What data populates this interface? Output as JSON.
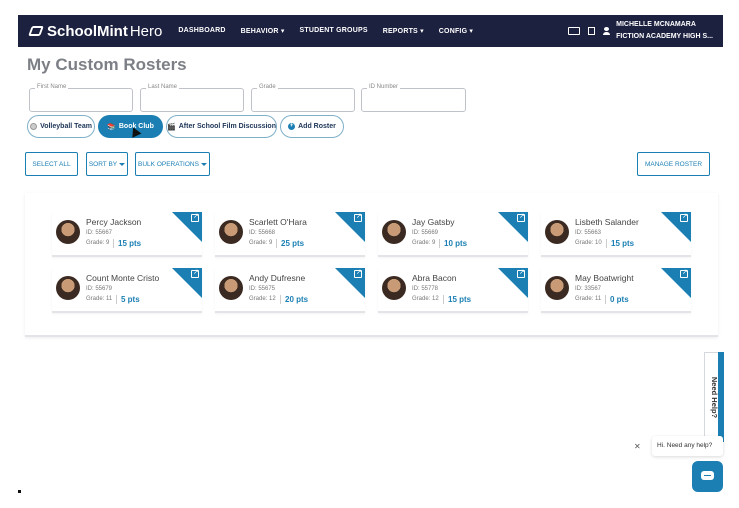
{
  "header": {
    "brand_bold": "SchoolMint",
    "brand_light": "Hero",
    "nav": [
      "DASHBOARD",
      "BEHAVIOR",
      "STUDENT GROUPS",
      "REPORTS",
      "CONFIG"
    ],
    "user_name": "MICHELLE MCNAMARA",
    "school": "FICTION ACADEMY HIGH S..."
  },
  "page": {
    "title": "My Custom Rosters"
  },
  "filters": {
    "first_name": "First Name",
    "last_name": "Last Name",
    "grade": "Grade",
    "id_number": "ID Number"
  },
  "rosters": {
    "items": [
      "Volleyball Team",
      "Book Club",
      "After School Film Discussion"
    ],
    "active": "Book Club",
    "add_label": "Add Roster"
  },
  "toolbar": {
    "select_all": "SELECT ALL",
    "sort_by": "SORT BY",
    "bulk_operations": "BULK OPERATIONS",
    "manage_roster": "MANAGE ROSTER"
  },
  "students": [
    {
      "name": "Percy Jackson",
      "id": "ID: 55667",
      "grade": "Grade: 9",
      "points": "15 pts"
    },
    {
      "name": "Scarlett O'Hara",
      "id": "ID: 55668",
      "grade": "Grade: 9",
      "points": "25 pts"
    },
    {
      "name": "Jay Gatsby",
      "id": "ID: 55669",
      "grade": "Grade: 9",
      "points": "10 pts"
    },
    {
      "name": "Lisbeth Salander",
      "id": "ID: 55663",
      "grade": "Grade: 10",
      "points": "15 pts"
    },
    {
      "name": "Count Monte Cristo",
      "id": "ID: 55679",
      "grade": "Grade: 11",
      "points": "5 pts"
    },
    {
      "name": "Andy Dufresne",
      "id": "ID: 55675",
      "grade": "Grade: 12",
      "points": "20 pts"
    },
    {
      "name": "Abra Bacon",
      "id": "ID: 55778",
      "grade": "Grade: 12",
      "points": "15 pts"
    },
    {
      "name": "May Boatwright",
      "id": "ID: 33567",
      "grade": "Grade: 11",
      "points": "0 pts"
    }
  ],
  "help": {
    "tab_label": "Need Help?",
    "chat_greeting": "Hi. Need any help?"
  },
  "colors": {
    "nav_bg": "#1d2140",
    "accent": "#1b7fb3"
  }
}
